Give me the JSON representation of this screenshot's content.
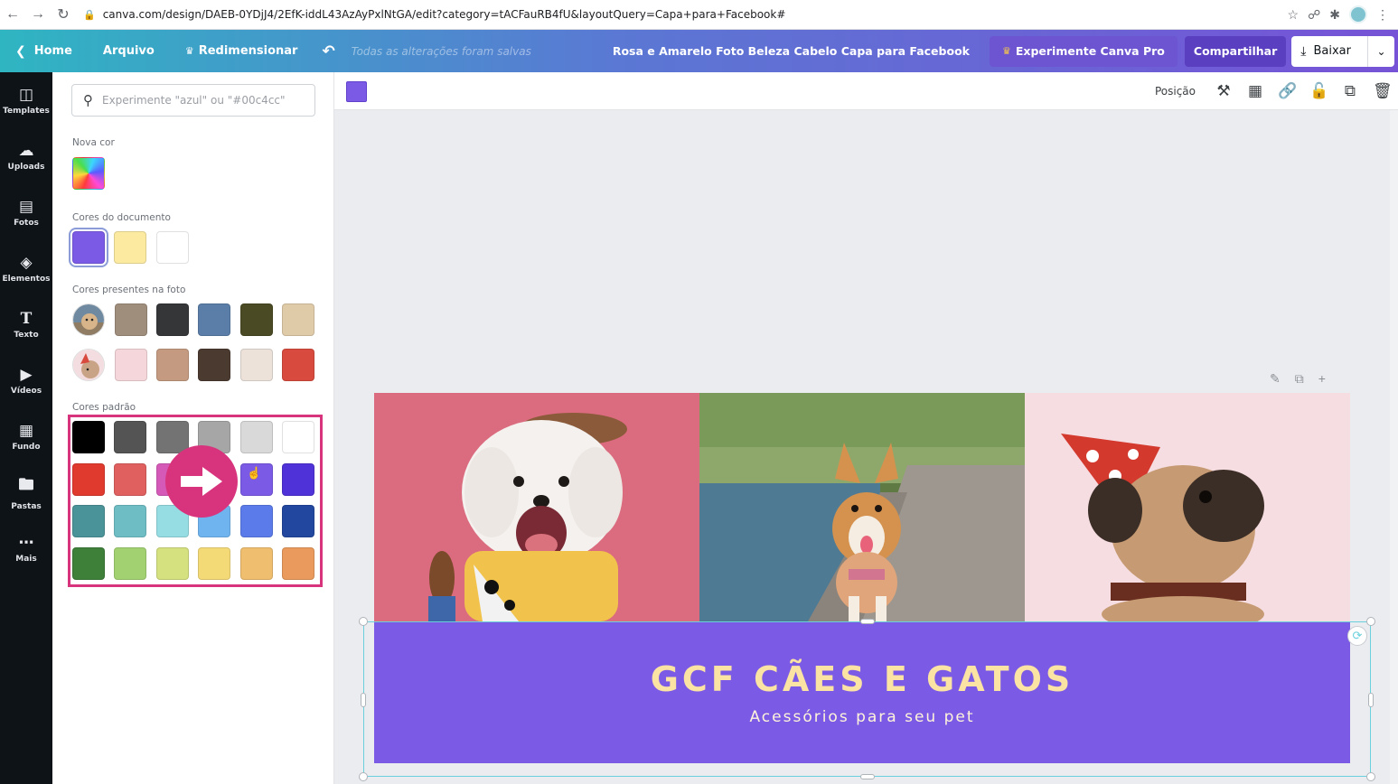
{
  "browser": {
    "url": "canva.com/design/DAEB-0YDjJ4/2EfK-iddL43AzAyPxlNtGA/edit?category=tACFauRB4fU&layoutQuery=Capa+para+Facebook#"
  },
  "topbar": {
    "home": "Home",
    "file": "Arquivo",
    "resize": "Redimensionar",
    "save_status": "Todas as alterações foram salvas",
    "doc_title": "Rosa e Amarelo Foto Beleza Cabelo Capa para Facebook",
    "pro": "Experimente Canva Pro",
    "share": "Compartilhar",
    "download": "Baixar"
  },
  "leftnav": {
    "items": [
      {
        "label": "Templates",
        "icon": "templates-icon"
      },
      {
        "label": "Uploads",
        "icon": "upload-icon"
      },
      {
        "label": "Fotos",
        "icon": "photos-icon"
      },
      {
        "label": "Elementos",
        "icon": "elements-icon"
      },
      {
        "label": "Texto",
        "icon": "text-icon"
      },
      {
        "label": "Vídeos",
        "icon": "video-icon"
      },
      {
        "label": "Fundo",
        "icon": "background-icon"
      },
      {
        "label": "Pastas",
        "icon": "folder-icon"
      },
      {
        "label": "Mais",
        "icon": "more-icon"
      }
    ]
  },
  "panel": {
    "search_placeholder": "Experimente \"azul\" ou \"#00c4cc\"",
    "new_color_label": "Nova cor",
    "doc_colors_label": "Cores do documento",
    "doc_colors": [
      "#7b5ae6",
      "#fbeaa0",
      "#ffffff"
    ],
    "photo_colors_label": "Cores presentes na foto",
    "photo_colors_row1": [
      "#a08e7c",
      "#343638",
      "#5a7ea8",
      "#4a4a25",
      "#e0cba8"
    ],
    "photo_colors_row2": [
      "#f5d6da",
      "#c49a80",
      "#4a3a30",
      "#ece2da",
      "#d94a3e"
    ],
    "default_colors_label": "Cores padrão",
    "default_colors": [
      [
        "#000000",
        "#545454",
        "#737373",
        "#a6a6a6",
        "#d9d9d9",
        "#ffffff"
      ],
      [
        "#e03a2e",
        "#e06060",
        "#d55ab8",
        "#a05ae0",
        "#7b5ae6",
        "#5033d8"
      ],
      [
        "#4a9399",
        "#6ebdc5",
        "#95dde3",
        "#6fb4ef",
        "#5b7bea",
        "#22479e"
      ],
      [
        "#3e7f3a",
        "#a2d171",
        "#d5e07e",
        "#f4da77",
        "#efbe6f",
        "#e99a5c"
      ]
    ]
  },
  "context_bar": {
    "position": "Posição",
    "selected_color": "#7b5ae6"
  },
  "design": {
    "title": "GCF CÃES E GATOS",
    "subtitle": "Acessórios para seu pet",
    "banner_color": "#7b5ae6"
  }
}
